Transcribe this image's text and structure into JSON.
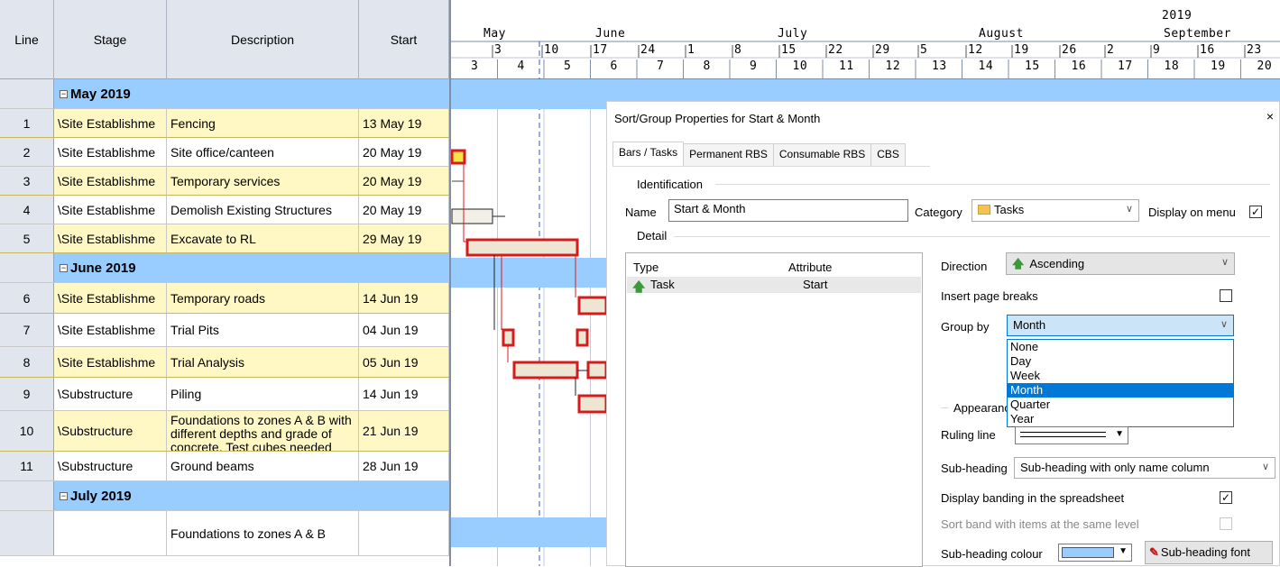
{
  "columns": {
    "line": "Line",
    "stage": "Stage",
    "description": "Description",
    "start": "Start"
  },
  "rows": [
    {
      "kind": "group",
      "label": "May 2019"
    },
    {
      "kind": "task",
      "line": "1",
      "stage": "\\Site Establishme",
      "desc": "Fencing",
      "start": "13 May 19",
      "yellow": true
    },
    {
      "kind": "task",
      "line": "2",
      "stage": "\\Site Establishme",
      "desc": "Site office/canteen",
      "start": "20 May 19",
      "yellow": false
    },
    {
      "kind": "task",
      "line": "3",
      "stage": "\\Site Establishme",
      "desc": "Temporary services",
      "start": "20 May 19",
      "yellow": true
    },
    {
      "kind": "task",
      "line": "4",
      "stage": "\\Site Establishme",
      "desc": "Demolish Existing Structures",
      "start": "20 May 19",
      "yellow": false
    },
    {
      "kind": "task",
      "line": "5",
      "stage": "\\Site Establishme",
      "desc": "Excavate to RL",
      "start": "29 May 19",
      "yellow": true
    },
    {
      "kind": "group",
      "label": "June 2019"
    },
    {
      "kind": "task",
      "line": "6",
      "stage": "\\Site Establishme",
      "desc": "Temporary roads",
      "start": "14 Jun 19",
      "yellow": true
    },
    {
      "kind": "task",
      "line": "7",
      "stage": "\\Site Establishme",
      "desc": "Trial Pits",
      "start": "04 Jun 19",
      "yellow": false
    },
    {
      "kind": "task",
      "line": "8",
      "stage": "\\Site Establishme",
      "desc": "Trial Analysis",
      "start": "05 Jun 19",
      "yellow": true
    },
    {
      "kind": "task",
      "line": "9",
      "stage": "\\Substructure",
      "desc": "Piling",
      "start": "14 Jun 19",
      "yellow": false
    },
    {
      "kind": "task",
      "line": "10",
      "stage": "\\Substructure",
      "desc": "Foundations to zones A & B with different depths and grade of concrete. Test cubes needed beforehand.",
      "start": "21 Jun 19",
      "yellow": true
    },
    {
      "kind": "task",
      "line": "11",
      "stage": "\\Substructure",
      "desc": "Ground beams",
      "start": "28 Jun 19",
      "yellow": false
    },
    {
      "kind": "group",
      "label": "July 2019"
    },
    {
      "kind": "task",
      "line": "",
      "stage": "",
      "desc": "Foundations to zones A & B",
      "start": "",
      "yellow": false
    }
  ],
  "timeline": {
    "year": "2019",
    "months": [
      "May",
      "June",
      "July",
      "August",
      "September"
    ],
    "weeks": [
      "3",
      "10",
      "17",
      "24",
      "1",
      "8",
      "15",
      "22",
      "29",
      "5",
      "12",
      "19",
      "26",
      "2",
      "9",
      "16",
      "23"
    ],
    "periods": [
      "3",
      "4",
      "5",
      "6",
      "7",
      "8",
      "9",
      "10",
      "11",
      "12",
      "13",
      "14",
      "15",
      "16",
      "17",
      "18",
      "19",
      "20"
    ]
  },
  "dialog": {
    "title": "Sort/Group Properties for Start & Month",
    "close": "×",
    "tabs": [
      "Bars / Tasks",
      "Permanent RBS",
      "Consumable RBS",
      "CBS"
    ],
    "identification": "Identification",
    "name_label": "Name",
    "name_value": "Start & Month",
    "category_label": "Category",
    "category_value": "Tasks",
    "display_on_menu": "Display on menu",
    "detail": "Detail",
    "type_header": "Type",
    "attribute_header": "Attribute",
    "type_value": "Task",
    "attribute_value": "Start",
    "direction_label": "Direction",
    "direction_value": "Ascending",
    "insert_page_breaks": "Insert page breaks",
    "group_by_label": "Group by",
    "group_by_value": "Month",
    "group_by_options": [
      "None",
      "Day",
      "Week",
      "Month",
      "Quarter",
      "Year"
    ],
    "appearance": "Appearance",
    "ruling_line": "Ruling line",
    "subheading_label": "Sub-heading",
    "subheading_value": "Sub-heading with only name column",
    "display_banding": "Display banding in the spreadsheet",
    "sort_band": "Sort band with items at the same level",
    "subheading_colour": "Sub-heading colour",
    "subheading_font": "Sub-heading font"
  }
}
